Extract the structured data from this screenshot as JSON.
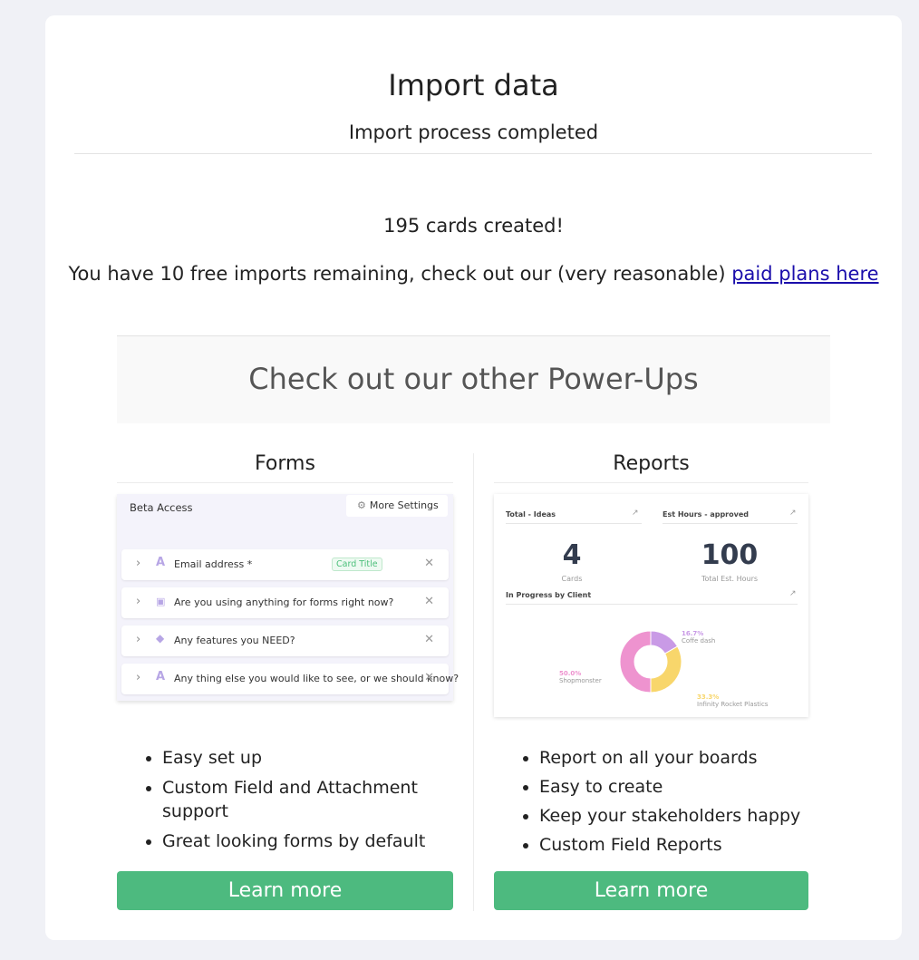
{
  "header": {
    "title": "Import data",
    "subtitle": "Import process completed"
  },
  "result": {
    "cards_created": "195 cards created!",
    "remaining_text": "You have 10 free imports remaining, check out our (very reasonable)",
    "paid_plans_link": "paid plans here"
  },
  "powerups": {
    "heading": "Check out our other Power-Ups",
    "forms": {
      "title": "Forms",
      "preview": {
        "header": "Beta Access",
        "settings_label": "More Settings",
        "fields": [
          {
            "text": "Email address *",
            "icon": "text-icon",
            "badge": "Card Title"
          },
          {
            "text": "Are you using anything for forms right now?",
            "icon": "dropdown-icon",
            "badge": ""
          },
          {
            "text": "Any features you NEED?",
            "icon": "tag-icon",
            "badge": ""
          },
          {
            "text": "Any thing else you would like to see, or we should know?",
            "icon": "text-icon",
            "badge": ""
          }
        ]
      },
      "features": [
        "Easy set up",
        "Custom Field and Attachment support",
        "Great looking forms by default"
      ],
      "button_label": "Learn more"
    },
    "reports": {
      "title": "Reports",
      "preview": {
        "widget1_label": "Total - Ideas",
        "widget1_value": "4",
        "widget1_unit": "Cards",
        "widget2_label": "Est Hours - approved",
        "widget2_value": "100",
        "widget2_unit": "Total Est. Hours",
        "chart_label": "In Progress by Client",
        "chart_data": {
          "type": "pie",
          "slices": [
            {
              "name": "Coffe dash",
              "value": 16.7,
              "pct": "16.7%",
              "color": "#c99ae6"
            },
            {
              "name": "Infinity Rocket Plastics",
              "value": 33.3,
              "pct": "33.3%",
              "color": "#f8d66b"
            },
            {
              "name": "Shopmonster",
              "value": 50.0,
              "pct": "50.0%",
              "color": "#ee93cf"
            }
          ]
        }
      },
      "features": [
        "Report on all your boards",
        "Easy to create",
        "Keep your stakeholders happy",
        "Custom Field Reports"
      ],
      "button_label": "Learn more"
    }
  }
}
